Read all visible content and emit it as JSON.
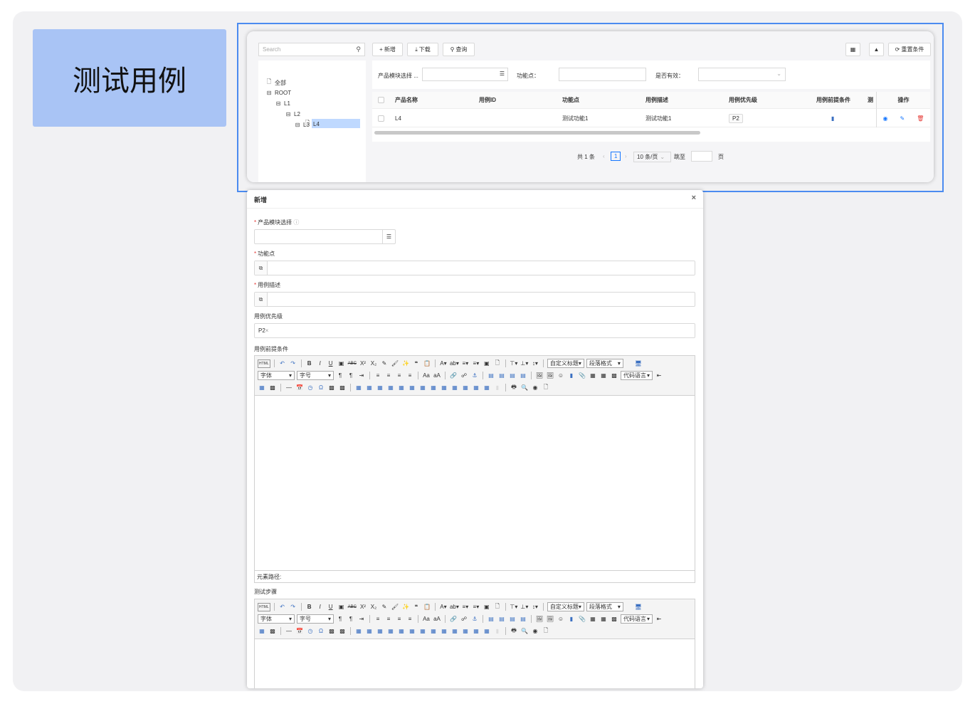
{
  "page_title": "测试用例",
  "colors": {
    "accent": "#1677ff",
    "title_card": "#a9c4f5",
    "frame": "#4b8bf0",
    "danger": "#e53935"
  },
  "toolbar": {
    "search_placeholder": "Search",
    "add_label": "新增",
    "download_label": "下载",
    "query_label": "查询",
    "reset_label": "重置条件"
  },
  "tree": {
    "all": "全部",
    "root": "ROOT",
    "l1": "L1",
    "l2": "L2",
    "l3": "L3",
    "l4": "L4"
  },
  "filters": {
    "module_label": "产品模块选择 ...",
    "feature_label": "功能点：",
    "valid_label": "是否有效："
  },
  "table": {
    "headers": [
      "产品名称",
      "用例ID",
      "功能点",
      "用例描述",
      "用例优先级",
      "用例前提条件",
      "测",
      "操作"
    ],
    "rows": [
      {
        "product": "L4",
        "case_id": "",
        "feature": "测试功能1",
        "desc": "测试功能1",
        "priority": "P2"
      }
    ]
  },
  "pager": {
    "total": "共 1 条",
    "current": "1",
    "size": "10 条/页",
    "jump_label": "跳至",
    "page_suffix": "页"
  },
  "modal": {
    "title": "新增",
    "close": "×",
    "module_label": "产品模块选择",
    "feature_label": "功能点",
    "desc_label": "用例描述",
    "priority_label": "用例优先级",
    "priority_value": "P2",
    "pre_label": "用例前提条件",
    "path_label": "元素路径:",
    "steps_label": "测试步骤"
  },
  "editor": {
    "font_select": "字体",
    "size_select": "字号",
    "title_select": "自定义标题",
    "para_select": "段落格式",
    "code_select": "代码语言",
    "html_btn": "HTML"
  }
}
